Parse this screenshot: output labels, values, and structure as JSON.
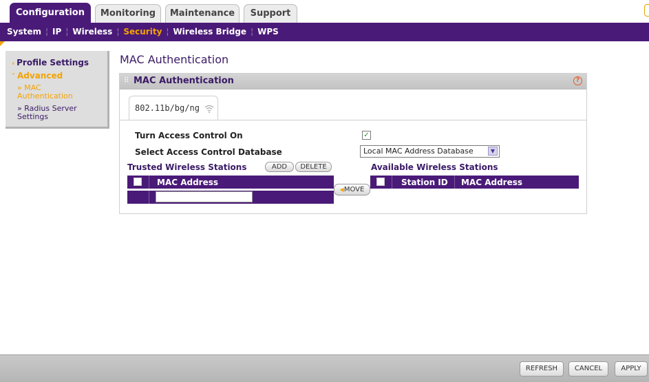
{
  "top_tabs": [
    {
      "label": "Configuration",
      "active": true
    },
    {
      "label": "Monitoring",
      "active": false
    },
    {
      "label": "Maintenance",
      "active": false
    },
    {
      "label": "Support",
      "active": false
    }
  ],
  "sub_nav": [
    {
      "label": "System",
      "active": false
    },
    {
      "label": "IP",
      "active": false
    },
    {
      "label": "Wireless",
      "active": false
    },
    {
      "label": "Security",
      "active": true
    },
    {
      "label": "Wireless Bridge",
      "active": false
    },
    {
      "label": "WPS",
      "active": false
    }
  ],
  "sidebar": {
    "profile_settings": "Profile Settings",
    "advanced": "Advanced",
    "mac_auth": "MAC Authentication",
    "radius": "Radius Server Settings"
  },
  "page_title": "MAC Authentication",
  "panel": {
    "title": "MAC Authentication",
    "help_glyph": "?",
    "band_tab": "802.11b/bg/ng",
    "turn_access_label": "Turn Access Control On",
    "turn_access_checked": true,
    "select_db_label": "Select Access Control Database",
    "select_db_value": "Local MAC Address Database",
    "trusted_title": "Trusted Wireless Stations",
    "add_label": "ADD",
    "delete_label": "DELETE",
    "trusted_col_mac": "MAC Address",
    "mac_input_value": "",
    "move_label": "MOVE",
    "available_title": "Available Wireless Stations",
    "available_col_station": "Station ID",
    "available_col_mac": "MAC Address"
  },
  "footer": {
    "refresh": "REFRESH",
    "cancel": "CANCEL",
    "apply": "APPLY"
  },
  "colors": {
    "brand_purple": "#4a1a78",
    "accent_orange": "#f4a300"
  }
}
